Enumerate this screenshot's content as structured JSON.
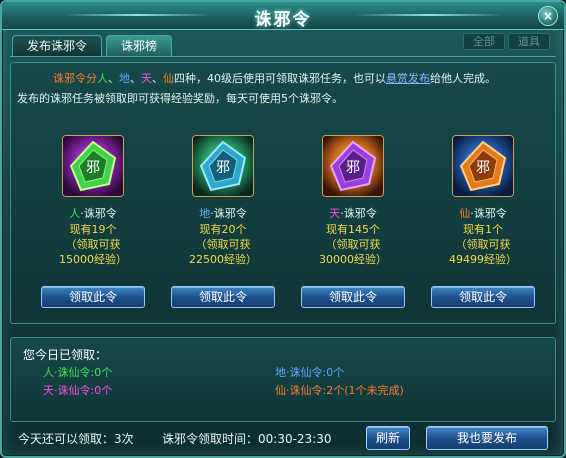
{
  "window": {
    "title": "诛邪令",
    "close_label": "×"
  },
  "tabs": [
    {
      "label": "发布诛邪令",
      "active": false
    },
    {
      "label": "诛邪榜",
      "active": true
    }
  ],
  "filter_tabs": [
    {
      "label": "全部"
    },
    {
      "label": "道具"
    }
  ],
  "description": {
    "line1": {
      "p1": "诛邪令分",
      "ren": "人",
      "s1": "、",
      "di": "地",
      "s2": "、",
      "tian": "天",
      "s3": "、",
      "xian": "仙",
      "p2": "四种，40级后使用可领取诛邪任务，也可以",
      "link": "悬赏发布",
      "p3": "给他人完成。"
    },
    "line2": "发布的诛邪任务被领取即可获得经验奖励，每天可使用5个诛邪令。"
  },
  "cards": [
    {
      "name_prefix": "人",
      "name_suffix": "·诛邪令",
      "count": "现有19个",
      "reward_line1": "（领取可获",
      "reward_line2": "15000经验）",
      "button": "领取此令",
      "color": "#3fe05a",
      "icon": "green-rune-token-icon"
    },
    {
      "name_prefix": "地",
      "name_suffix": "·诛邪令",
      "count": "现有20个",
      "reward_line1": "（领取可获",
      "reward_line2": "22500经验）",
      "button": "领取此令",
      "color": "#5fa8ff",
      "icon": "teal-rune-token-icon"
    },
    {
      "name_prefix": "天",
      "name_suffix": "·诛邪令",
      "count": "现有145个",
      "reward_line1": "（领取可获",
      "reward_line2": "30000经验）",
      "button": "领取此令",
      "color": "#ff4de0",
      "icon": "purple-rune-token-icon"
    },
    {
      "name_prefix": "仙",
      "name_suffix": "·诛邪令",
      "count": "现有1个",
      "reward_line1": "（领取可获",
      "reward_line2": "49499经验）",
      "button": "领取此令",
      "color": "#ff7a2e",
      "icon": "orange-rune-token-icon"
    }
  ],
  "today": {
    "title": "您今日已领取：",
    "items": [
      {
        "label": "人·诛仙令:0个",
        "color": "#3fe05a"
      },
      {
        "label": "地·诛仙令:0个",
        "color": "#5fa8ff"
      },
      {
        "label": "天·诛仙令:0个",
        "color": "#ff4de0"
      },
      {
        "label": "仙·诛仙令:2个(1个未完成)",
        "color": "#ff7a2e"
      }
    ]
  },
  "footer": {
    "remaining": "今天还可以领取：3次",
    "time": "诛邪令领取时间：00:30-23:30",
    "refresh_button": "刷新",
    "publish_button": "我也要发布"
  }
}
